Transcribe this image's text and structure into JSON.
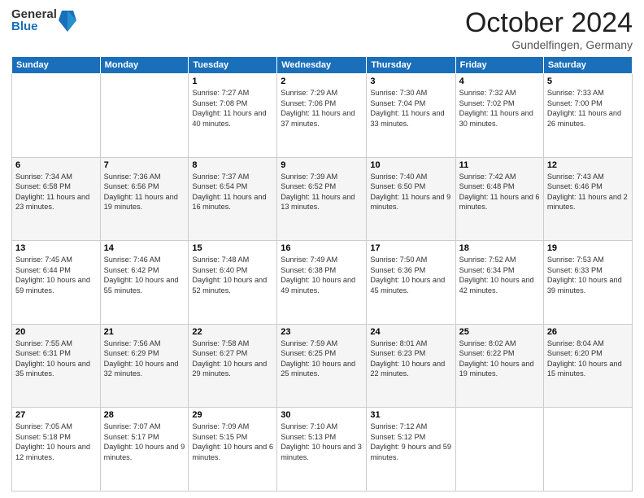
{
  "header": {
    "logo_general": "General",
    "logo_blue": "Blue",
    "month_title": "October 2024",
    "location": "Gundelfingen, Germany"
  },
  "weekdays": [
    "Sunday",
    "Monday",
    "Tuesday",
    "Wednesday",
    "Thursday",
    "Friday",
    "Saturday"
  ],
  "weeks": [
    [
      {
        "day": "",
        "info": ""
      },
      {
        "day": "",
        "info": ""
      },
      {
        "day": "1",
        "info": "Sunrise: 7:27 AM\nSunset: 7:08 PM\nDaylight: 11 hours and 40 minutes."
      },
      {
        "day": "2",
        "info": "Sunrise: 7:29 AM\nSunset: 7:06 PM\nDaylight: 11 hours and 37 minutes."
      },
      {
        "day": "3",
        "info": "Sunrise: 7:30 AM\nSunset: 7:04 PM\nDaylight: 11 hours and 33 minutes."
      },
      {
        "day": "4",
        "info": "Sunrise: 7:32 AM\nSunset: 7:02 PM\nDaylight: 11 hours and 30 minutes."
      },
      {
        "day": "5",
        "info": "Sunrise: 7:33 AM\nSunset: 7:00 PM\nDaylight: 11 hours and 26 minutes."
      }
    ],
    [
      {
        "day": "6",
        "info": "Sunrise: 7:34 AM\nSunset: 6:58 PM\nDaylight: 11 hours and 23 minutes."
      },
      {
        "day": "7",
        "info": "Sunrise: 7:36 AM\nSunset: 6:56 PM\nDaylight: 11 hours and 19 minutes."
      },
      {
        "day": "8",
        "info": "Sunrise: 7:37 AM\nSunset: 6:54 PM\nDaylight: 11 hours and 16 minutes."
      },
      {
        "day": "9",
        "info": "Sunrise: 7:39 AM\nSunset: 6:52 PM\nDaylight: 11 hours and 13 minutes."
      },
      {
        "day": "10",
        "info": "Sunrise: 7:40 AM\nSunset: 6:50 PM\nDaylight: 11 hours and 9 minutes."
      },
      {
        "day": "11",
        "info": "Sunrise: 7:42 AM\nSunset: 6:48 PM\nDaylight: 11 hours and 6 minutes."
      },
      {
        "day": "12",
        "info": "Sunrise: 7:43 AM\nSunset: 6:46 PM\nDaylight: 11 hours and 2 minutes."
      }
    ],
    [
      {
        "day": "13",
        "info": "Sunrise: 7:45 AM\nSunset: 6:44 PM\nDaylight: 10 hours and 59 minutes."
      },
      {
        "day": "14",
        "info": "Sunrise: 7:46 AM\nSunset: 6:42 PM\nDaylight: 10 hours and 55 minutes."
      },
      {
        "day": "15",
        "info": "Sunrise: 7:48 AM\nSunset: 6:40 PM\nDaylight: 10 hours and 52 minutes."
      },
      {
        "day": "16",
        "info": "Sunrise: 7:49 AM\nSunset: 6:38 PM\nDaylight: 10 hours and 49 minutes."
      },
      {
        "day": "17",
        "info": "Sunrise: 7:50 AM\nSunset: 6:36 PM\nDaylight: 10 hours and 45 minutes."
      },
      {
        "day": "18",
        "info": "Sunrise: 7:52 AM\nSunset: 6:34 PM\nDaylight: 10 hours and 42 minutes."
      },
      {
        "day": "19",
        "info": "Sunrise: 7:53 AM\nSunset: 6:33 PM\nDaylight: 10 hours and 39 minutes."
      }
    ],
    [
      {
        "day": "20",
        "info": "Sunrise: 7:55 AM\nSunset: 6:31 PM\nDaylight: 10 hours and 35 minutes."
      },
      {
        "day": "21",
        "info": "Sunrise: 7:56 AM\nSunset: 6:29 PM\nDaylight: 10 hours and 32 minutes."
      },
      {
        "day": "22",
        "info": "Sunrise: 7:58 AM\nSunset: 6:27 PM\nDaylight: 10 hours and 29 minutes."
      },
      {
        "day": "23",
        "info": "Sunrise: 7:59 AM\nSunset: 6:25 PM\nDaylight: 10 hours and 25 minutes."
      },
      {
        "day": "24",
        "info": "Sunrise: 8:01 AM\nSunset: 6:23 PM\nDaylight: 10 hours and 22 minutes."
      },
      {
        "day": "25",
        "info": "Sunrise: 8:02 AM\nSunset: 6:22 PM\nDaylight: 10 hours and 19 minutes."
      },
      {
        "day": "26",
        "info": "Sunrise: 8:04 AM\nSunset: 6:20 PM\nDaylight: 10 hours and 15 minutes."
      }
    ],
    [
      {
        "day": "27",
        "info": "Sunrise: 7:05 AM\nSunset: 5:18 PM\nDaylight: 10 hours and 12 minutes."
      },
      {
        "day": "28",
        "info": "Sunrise: 7:07 AM\nSunset: 5:17 PM\nDaylight: 10 hours and 9 minutes."
      },
      {
        "day": "29",
        "info": "Sunrise: 7:09 AM\nSunset: 5:15 PM\nDaylight: 10 hours and 6 minutes."
      },
      {
        "day": "30",
        "info": "Sunrise: 7:10 AM\nSunset: 5:13 PM\nDaylight: 10 hours and 3 minutes."
      },
      {
        "day": "31",
        "info": "Sunrise: 7:12 AM\nSunset: 5:12 PM\nDaylight: 9 hours and 59 minutes."
      },
      {
        "day": "",
        "info": ""
      },
      {
        "day": "",
        "info": ""
      }
    ]
  ]
}
